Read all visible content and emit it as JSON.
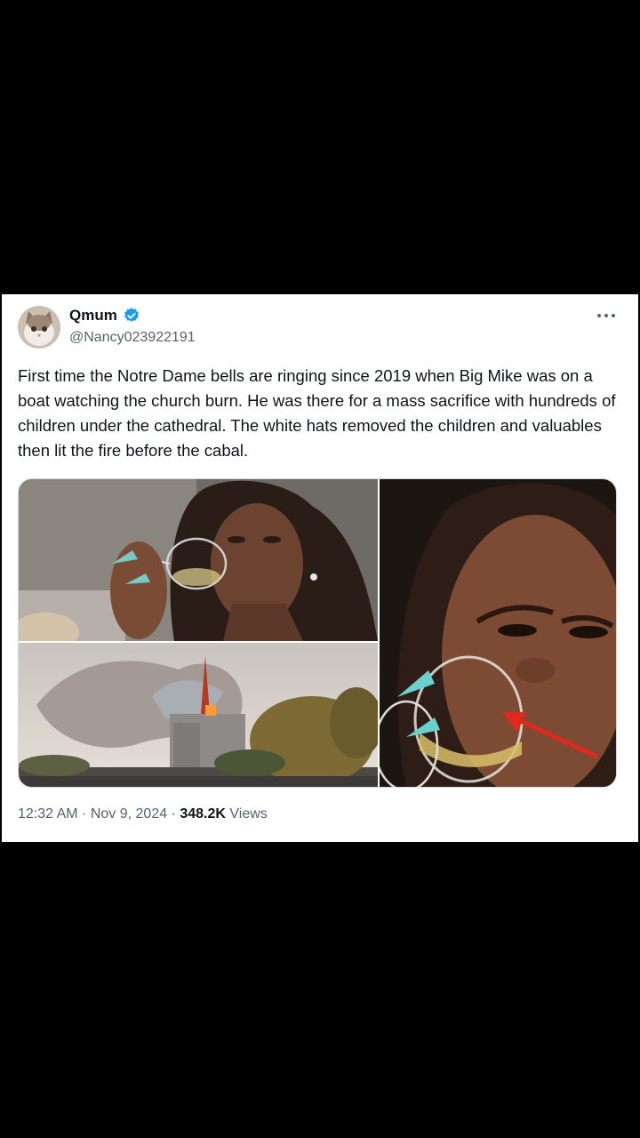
{
  "tweet": {
    "display_name": "Qmum",
    "handle": "@Nancy023922191",
    "verified_icon": "verified-badge-icon",
    "more_icon": "more-options-icon",
    "text": "First time the Notre Dame bells are ringing since 2019 when Big Mike was on a boat watching the church burn. He was there for a mass sacrifice with hundreds of children under the cathedral. The white hats removed the children and valuables then lit the fire before the cabal.",
    "media": [
      {
        "subject": "woman-drinking-wine-photo"
      },
      {
        "subject": "cathedral-fire-photo"
      },
      {
        "subject": "wine-glass-closeup-photo"
      }
    ],
    "time": "12:32 AM",
    "sep1": " · ",
    "date": "Nov 9, 2024",
    "sep2": " · ",
    "views_count": "348.2K",
    "views_label": "Views"
  },
  "colors": {
    "accent": "#1d9bf0",
    "text_primary": "#0f1419",
    "text_secondary": "#536471",
    "background": "#000000",
    "card": "#ffffff",
    "arrow": "#e0281e"
  }
}
